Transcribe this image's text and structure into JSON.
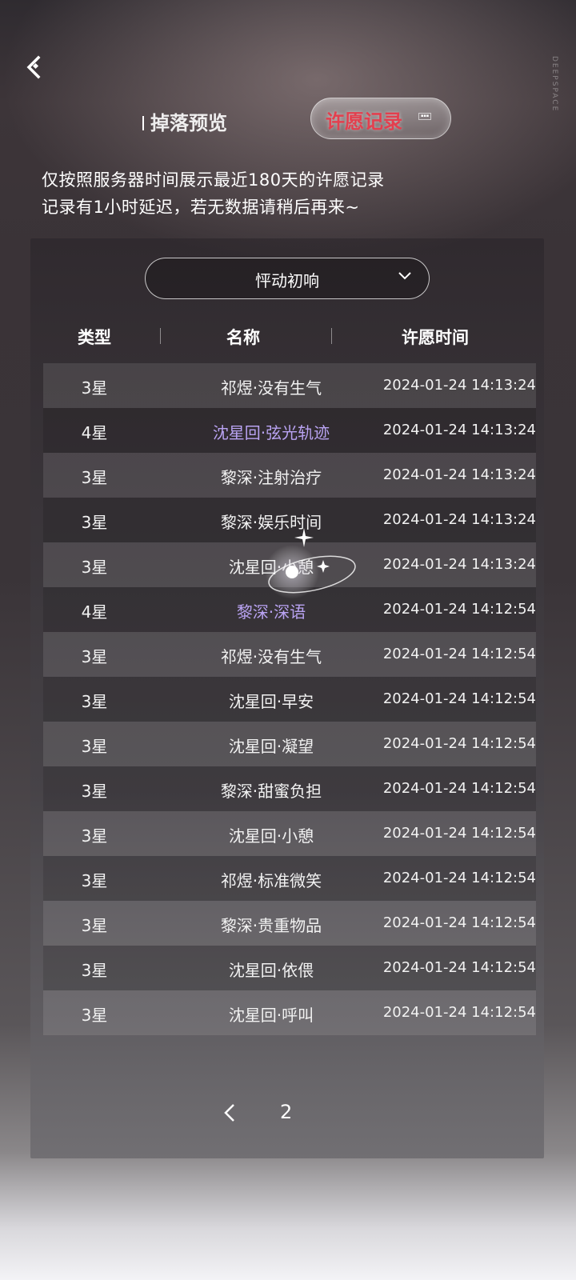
{
  "header": {
    "back_icon": "back-arrow-icon",
    "brand_vertical": "DEEPSPACE",
    "tabs": [
      {
        "label": "掉落预览",
        "active": false
      },
      {
        "label": "许愿记录",
        "active": true
      }
    ],
    "accent_color": "#e33f4e"
  },
  "notice": {
    "line1": "仅按照服务器时间展示最近180天的许愿记录",
    "line2": "记录有1小时延迟，若无数据请稍后再来~"
  },
  "filter": {
    "selected": "怦动初响",
    "icon": "chevron-down-icon"
  },
  "table": {
    "headers": [
      "类型",
      "名称",
      "许愿时间"
    ],
    "highlight_color": "#b9a3f2",
    "rows": [
      {
        "type": "3星",
        "name": "祁煜·没有生气",
        "time": "2024-01-24 14:13:24",
        "highlight": false
      },
      {
        "type": "4星",
        "name": "沈星回·弦光轨迹",
        "time": "2024-01-24 14:13:24",
        "highlight": true
      },
      {
        "type": "3星",
        "name": "黎深·注射治疗",
        "time": "2024-01-24 14:13:24",
        "highlight": false
      },
      {
        "type": "3星",
        "name": "黎深·娱乐时间",
        "time": "2024-01-24 14:13:24",
        "highlight": false
      },
      {
        "type": "3星",
        "name": "沈星回·小憩",
        "time": "2024-01-24 14:13:24",
        "highlight": false
      },
      {
        "type": "4星",
        "name": "黎深·深语",
        "time": "2024-01-24 14:12:54",
        "highlight": true
      },
      {
        "type": "3星",
        "name": "祁煜·没有生气",
        "time": "2024-01-24 14:12:54",
        "highlight": false
      },
      {
        "type": "3星",
        "name": "沈星回·早安",
        "time": "2024-01-24 14:12:54",
        "highlight": false
      },
      {
        "type": "3星",
        "name": "沈星回·凝望",
        "time": "2024-01-24 14:12:54",
        "highlight": false
      },
      {
        "type": "3星",
        "name": "黎深·甜蜜负担",
        "time": "2024-01-24 14:12:54",
        "highlight": false
      },
      {
        "type": "3星",
        "name": "沈星回·小憩",
        "time": "2024-01-24 14:12:54",
        "highlight": false
      },
      {
        "type": "3星",
        "name": "祁煜·标准微笑",
        "time": "2024-01-24 14:12:54",
        "highlight": false
      },
      {
        "type": "3星",
        "name": "黎深·贵重物品",
        "time": "2024-01-24 14:12:54",
        "highlight": false
      },
      {
        "type": "3星",
        "name": "沈星回·依偎",
        "time": "2024-01-24 14:12:54",
        "highlight": false
      },
      {
        "type": "3星",
        "name": "沈星回·呼叫",
        "time": "2024-01-24 14:12:54",
        "highlight": false
      }
    ]
  },
  "pagination": {
    "prev_icon": "chevron-left-icon",
    "current_page": "2"
  }
}
